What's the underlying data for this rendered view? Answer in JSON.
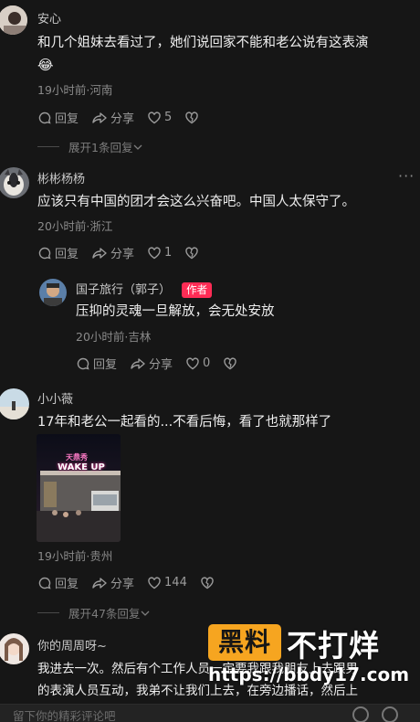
{
  "comments": [
    {
      "username": "安心",
      "text_lines": [
        "和几个姐妹去看过了，她们说回家不能和老公说有这表演",
        "😂"
      ],
      "meta": "19小时前·河南",
      "reply_label": "回复",
      "share_label": "分享",
      "like_count": "5",
      "expand_label": "展开1条回复"
    },
    {
      "username": "彬彬杨杨",
      "text_lines": [
        "应该只有中国的团才会这么兴奋吧。中国人太保守了。"
      ],
      "meta": "20小时前·浙江",
      "reply_label": "回复",
      "share_label": "分享",
      "like_count": "1",
      "reply": {
        "username": "国子旅行（郭子）",
        "badge": "作者",
        "text": "压抑的灵魂一旦解放，会无处安放",
        "meta": "20小时前·吉林",
        "reply_label": "回复",
        "share_label": "分享",
        "like_count": "0"
      }
    },
    {
      "username": "小小薇",
      "text_lines": [
        "17年和老公一起看的...不看后悔，看了也就那样了"
      ],
      "photo_sign_top": "天鼎秀",
      "photo_sign": "WAKE UP",
      "meta": "19小时前·贵州",
      "reply_label": "回复",
      "share_label": "分享",
      "like_count": "144",
      "expand_label": "展开47条回复"
    },
    {
      "username": "你的周周呀~",
      "text_lines": [
        "我进去一次。然后有个工作人员一定要我跟我朋友上去跟男",
        "的表演人员互动，我弟不让我们上去，在旁边播话，然后上"
      ]
    }
  ],
  "watermark": {
    "box_text": "黑料",
    "big_text": "不打烊",
    "url": "https://bbdy17.com"
  },
  "input": {
    "placeholder": "留下你的精彩评论吧"
  },
  "colors": {
    "background": "#161616",
    "author_badge": "#fe2c55",
    "watermark_box": "#f6a520"
  }
}
